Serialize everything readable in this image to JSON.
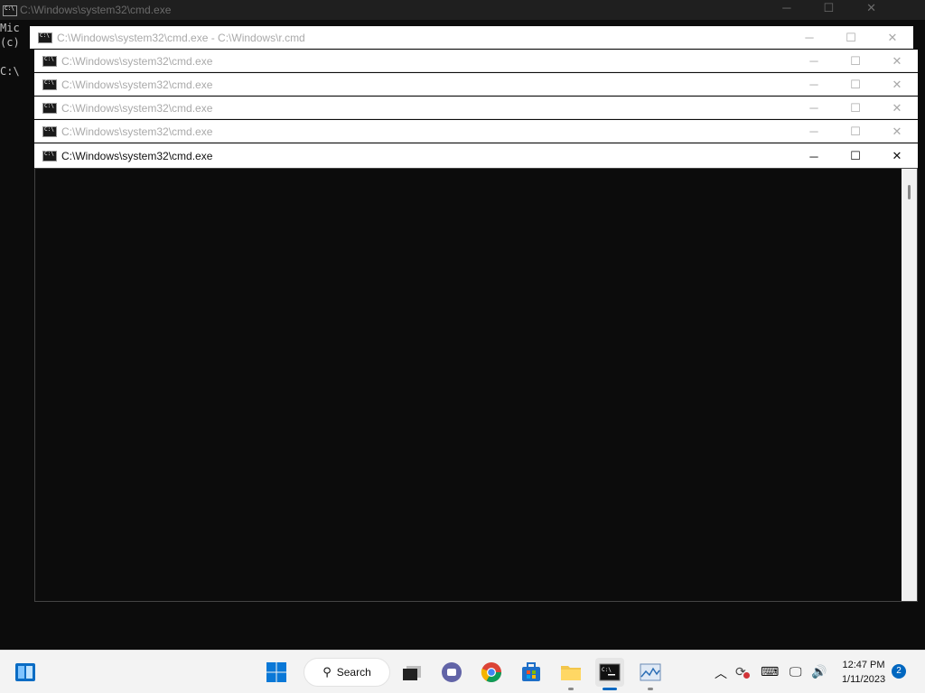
{
  "background_window": {
    "title": "C:\\Windows\\system32\\cmd.exe",
    "lines": [
      "Mic",
      "(c)",
      "C:\\"
    ]
  },
  "stacked_windows": [
    {
      "title": "C:\\Windows\\system32\\cmd.exe - C:\\Windows\\r.cmd",
      "active": false
    },
    {
      "title": "C:\\Windows\\system32\\cmd.exe",
      "active": false
    },
    {
      "title": "C:\\Windows\\system32\\cmd.exe",
      "active": false
    },
    {
      "title": "C:\\Windows\\system32\\cmd.exe",
      "active": false
    },
    {
      "title": "C:\\Windows\\system32\\cmd.exe",
      "active": false
    },
    {
      "title": "C:\\Windows\\system32\\cmd.exe",
      "active": true
    }
  ],
  "window_controls": {
    "minimize": "─",
    "maximize": "☐",
    "close": "✕"
  },
  "taskbar": {
    "search_label": "Search",
    "time": "12:47 PM",
    "date": "1/11/2023",
    "notification_count": "2",
    "apps": [
      {
        "name": "start-button",
        "icon": "windows-logo-icon"
      },
      {
        "name": "task-view",
        "icon": "task-view-icon"
      },
      {
        "name": "teams-chat",
        "icon": "chat-icon"
      },
      {
        "name": "chrome",
        "icon": "chrome-icon"
      },
      {
        "name": "microsoft-store",
        "icon": "store-icon"
      },
      {
        "name": "file-explorer",
        "icon": "folder-icon"
      },
      {
        "name": "command-prompt",
        "icon": "terminal-icon"
      },
      {
        "name": "performance-monitor",
        "icon": "chart-icon"
      }
    ],
    "accent_color": "#0067c0"
  }
}
